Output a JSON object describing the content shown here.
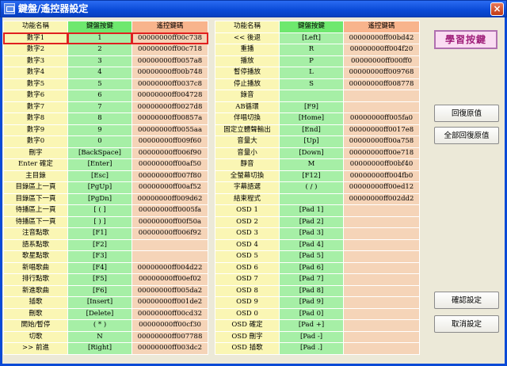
{
  "window": {
    "title": "鍵盤/遙控器設定",
    "close_label": "×"
  },
  "left_table": {
    "headers": [
      "功能名稱",
      "鍵盤按鍵",
      "遙控鍵碼"
    ],
    "rows": [
      [
        "數字1",
        "1",
        "00000000ff00c738"
      ],
      [
        "數字2",
        "2",
        "00000000ff00c718"
      ],
      [
        "數字3",
        "3",
        "00000000ff0057a8"
      ],
      [
        "數字4",
        "4",
        "00000000ff00b748"
      ],
      [
        "數字5",
        "5",
        "00000000ff0037c8"
      ],
      [
        "數字6",
        "6",
        "00000000ff004728"
      ],
      [
        "數字7",
        "7",
        "00000000ff0027d8"
      ],
      [
        "數字8",
        "8",
        "00000000ff00857a"
      ],
      [
        "數字9",
        "9",
        "00000000ff0055aa"
      ],
      [
        "數字0",
        "0",
        "00000000ff009f60"
      ],
      [
        "刪字",
        "[BackSpace]",
        "00000000ff006f90"
      ],
      [
        "Enter 確定",
        "[Enter]",
        "00000000ff00af50"
      ],
      [
        "主目錄",
        "[Esc]",
        "00000000ff007f80"
      ],
      [
        "目錄區上一頁",
        "[PgUp]",
        "00000000ff00af52"
      ],
      [
        "目錄區下一頁",
        "[PgDn]",
        "00000000ff009d62"
      ],
      [
        "待播區上一頁",
        "[ ( ]",
        "00000000ff0005fa"
      ],
      [
        "待播區下一頁",
        "[ ) ]",
        "00000000ff00f50a"
      ],
      [
        "注音點歌",
        "[F1]",
        "00000000ff006f92"
      ],
      [
        "語系點歌",
        "[F2]",
        ""
      ],
      [
        "歌星點歌",
        "[F3]",
        ""
      ],
      [
        "新唱歌曲",
        "[F4]",
        "00000000ff004d22"
      ],
      [
        "排行點歌",
        "[F5]",
        "00000000ff00ef02"
      ],
      [
        "新進歌曲",
        "[F6]",
        "00000000ff005da2"
      ],
      [
        "插歌",
        "[Insert]",
        "00000000ff001de2"
      ],
      [
        "刪歌",
        "[Delete]",
        "00000000ff00cd32"
      ],
      [
        "開始/暫停",
        "( * )",
        "00000000ff00cf30"
      ],
      [
        "切歌",
        "N",
        "00000000ff007788"
      ],
      [
        ">> 前進",
        "[Right]",
        "00000000ff003dc2"
      ]
    ]
  },
  "right_table": {
    "headers": [
      "功能名稱",
      "鍵盤按鍵",
      "遙控鍵碼"
    ],
    "rows": [
      [
        "<< 後退",
        "[Left]",
        "00000000ff00bd42"
      ],
      [
        "重播",
        "R",
        "00000000ff004f20"
      ],
      [
        "播放",
        "P",
        "00000000ff000ff0"
      ],
      [
        "暫停播放",
        "L",
        "00000000ff009768"
      ],
      [
        "停止播放",
        "S",
        "00000000ff008778"
      ],
      [
        "錄音",
        "",
        ""
      ],
      [
        "AB循環",
        "[F9]",
        ""
      ],
      [
        "伴唱切換",
        "[Home]",
        "00000000ff005fa0"
      ],
      [
        "固定立體聲輸出",
        "[End]",
        "00000000ff0017e8"
      ],
      [
        "音量大",
        "[Up]",
        "00000000ff00a758"
      ],
      [
        "音量小",
        "[Down]",
        "00000000ff00e718"
      ],
      [
        "靜音",
        "M",
        "00000000ff00bf40"
      ],
      [
        "全螢幕切換",
        "[F12]",
        "00000000ff004fb0"
      ],
      [
        "字幕語選",
        "( / )",
        "00000000ff00ed12"
      ],
      [
        "結束程式",
        "",
        "00000000ff002dd2"
      ],
      [
        "OSD 1",
        "[Pad 1]",
        ""
      ],
      [
        "OSD 2",
        "[Pad 2]",
        ""
      ],
      [
        "OSD 3",
        "[Pad 3]",
        ""
      ],
      [
        "OSD 4",
        "[Pad 4]",
        ""
      ],
      [
        "OSD 5",
        "[Pad 5]",
        ""
      ],
      [
        "OSD 6",
        "[Pad 6]",
        ""
      ],
      [
        "OSD 7",
        "[Pad 7]",
        ""
      ],
      [
        "OSD 8",
        "[Pad 8]",
        ""
      ],
      [
        "OSD 9",
        "[Pad 9]",
        ""
      ],
      [
        "OSD 0",
        "[Pad 0]",
        ""
      ],
      [
        "OSD 確定",
        "[Pad +]",
        ""
      ],
      [
        "OSD 刪字",
        "[Pad -]",
        ""
      ],
      [
        "OSD 插歌",
        "[Pad .]",
        ""
      ]
    ]
  },
  "buttons": {
    "learn": "學習按鍵",
    "restore": "回復原值",
    "restore_all": "全部回復原值",
    "confirm": "確認設定",
    "cancel": "取消設定"
  },
  "selected_row": 0
}
